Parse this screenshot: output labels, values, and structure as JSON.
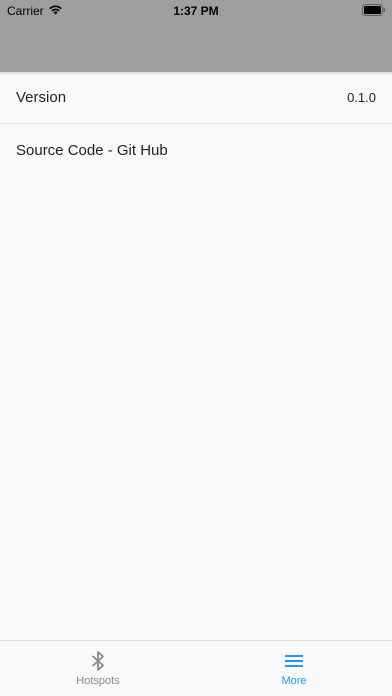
{
  "status_bar": {
    "carrier": "Carrier",
    "time": "1:37 PM"
  },
  "list": {
    "items": [
      {
        "label": "Version",
        "value": "0.1.0"
      },
      {
        "label": "Source Code - Git Hub"
      }
    ]
  },
  "tab_bar": {
    "tabs": [
      {
        "label": "Hotspots",
        "icon": "bluetooth-icon",
        "active": false
      },
      {
        "label": "More",
        "icon": "menu-icon",
        "active": true
      }
    ]
  },
  "colors": {
    "nav_bar": "#9e9e9e",
    "active_tab": "#2196f3",
    "inactive_tab": "#8a8a8a",
    "background": "#f9f9f9"
  }
}
